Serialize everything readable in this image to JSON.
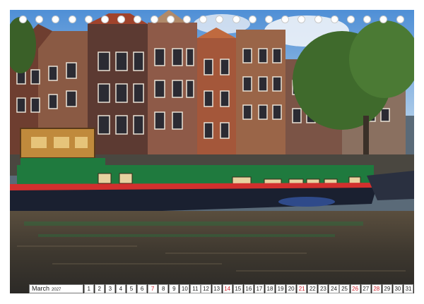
{
  "calendar": {
    "month": "March",
    "year": "2027",
    "days": [
      "1",
      "2",
      "3",
      "4",
      "5",
      "6",
      "7",
      "8",
      "9",
      "10",
      "11",
      "12",
      "13",
      "14",
      "15",
      "16",
      "17",
      "18",
      "19",
      "20",
      "21",
      "22",
      "23",
      "24",
      "25",
      "26",
      "27",
      "28",
      "29",
      "30",
      "31"
    ],
    "red_days": [
      "7",
      "14",
      "21",
      "26",
      "28"
    ]
  },
  "photo": {
    "subject": "houseboat-canal",
    "colors": {
      "sky": "#5c9bd8",
      "water": "#4a4237",
      "hull": "#1a2030",
      "boat_green": "#1f7a3e",
      "stripe": "#d2302e",
      "brick": "#7a4a3a"
    }
  },
  "binding_holes": 24
}
